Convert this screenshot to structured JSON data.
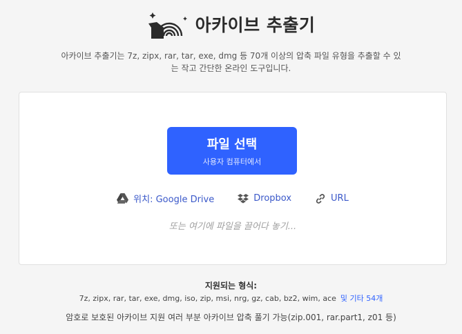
{
  "header": {
    "title": "아카이브 추출기",
    "logo_icon": "box-rainbow-icon"
  },
  "description": {
    "line1": "아카이브 추출기는 7z, zipx, rar, tar, exe, dmg 등 70개 이상의 압축 파일 유형을 추출할 수 있",
    "line2": "는 작고 간단한 온라인 도구입니다."
  },
  "card": {
    "select_button": {
      "label": "파일 선택",
      "sublabel": "사용자 컴퓨터에서"
    },
    "sources": [
      {
        "label": "위치: Google Drive",
        "icon": "google-drive-icon"
      },
      {
        "label": "Dropbox",
        "icon": "dropbox-icon"
      },
      {
        "label": "URL",
        "icon": "link-icon"
      }
    ],
    "drop_hint": "또는 여기에 파일을 끌어다 놓기..."
  },
  "formats": {
    "title": "지원되는 형식:",
    "list": "7z, zipx, rar, tar, exe, dmg, iso, zip, msi, nrg, gz, cab, bz2, wim, ace",
    "more_link": "및 기타 54개"
  },
  "footer_note": "암호로 보호된 아카이브 지원 여러 부분 아카이브 압축 풀기 가능(zip.001, rar.part1, z01 등)",
  "colors": {
    "accent": "#2f62ff",
    "link": "#3a58c9",
    "background": "#f5f5f5"
  }
}
